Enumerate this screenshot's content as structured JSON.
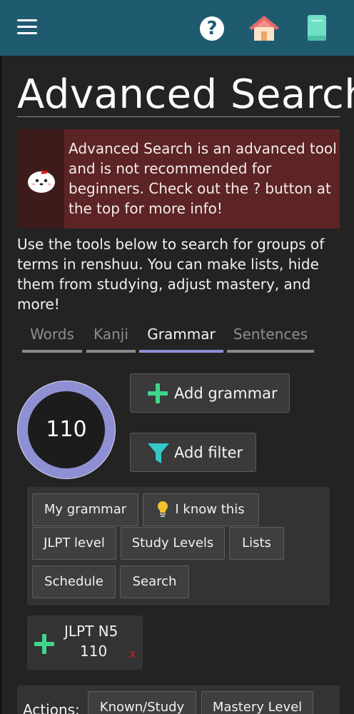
{
  "header": {
    "menu_icon": "hamburger-menu-icon",
    "help_icon": "help-question-icon",
    "help_glyph": "?",
    "home_icon": "home-icon",
    "book_icon": "book-icon",
    "color": "#1f5b6f"
  },
  "page": {
    "title": "Advanced Search"
  },
  "warning": {
    "text": "Advanced Search is an advanced tool and is not recommended for beginners. Check out the ? button at the top for more info!",
    "color": "#5c2424"
  },
  "intro": {
    "text": "Use the tools below to search for groups of terms in renshuu. You can make lists, hide them from studying, adjust mastery, and more!"
  },
  "tabs": [
    {
      "label": "Words",
      "active": false
    },
    {
      "label": "Kanji",
      "active": false
    },
    {
      "label": "Grammar",
      "active": true
    },
    {
      "label": "Sentences",
      "active": false
    }
  ],
  "result": {
    "count": "110",
    "ring_color": "#8f8fd4"
  },
  "buttons": {
    "add_grammar": "Add grammar",
    "add_filter": "Add filter"
  },
  "filters": {
    "my_grammar": "My grammar",
    "i_know_this": "I know this",
    "jlpt_level": "JLPT level",
    "study_levels": "Study Levels",
    "lists": "Lists",
    "schedule": "Schedule",
    "search": "Search"
  },
  "active_filter": {
    "label": "JLPT N5",
    "count": "110",
    "remove": "x"
  },
  "actions": {
    "label": "Actions:",
    "known_study": "Known/Study",
    "mastery_level": "Mastery Level"
  },
  "accent_colors": {
    "plus": "#3dd68a",
    "filter": "#33c9c9",
    "remove": "#d42020",
    "active_tab": "#8f8fd4"
  }
}
